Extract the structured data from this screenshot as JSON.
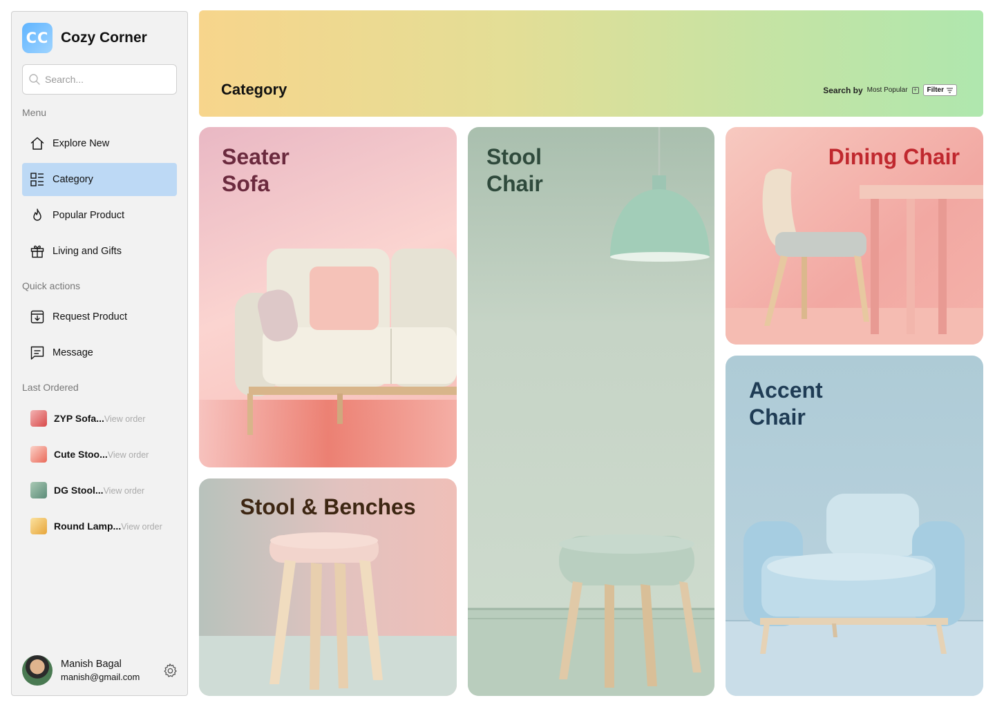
{
  "app": {
    "brand_initials": "CC",
    "brand_name": "Cozy Corner"
  },
  "search": {
    "placeholder": "Search..."
  },
  "sidebar": {
    "menu_title": "Menu",
    "menu": [
      {
        "label": "Explore New",
        "icon": "home-icon"
      },
      {
        "label": "Category",
        "icon": "category-list-icon",
        "active": true
      },
      {
        "label": "Popular Product",
        "icon": "flame-icon"
      },
      {
        "label": "Living and Gifts",
        "icon": "gift-icon"
      }
    ],
    "quick_title": "Quick actions",
    "quick": [
      {
        "label": "Request Product",
        "icon": "download-box-icon"
      },
      {
        "label": "Message",
        "icon": "message-icon"
      }
    ],
    "orders_title": "Last Ordered",
    "orders": [
      {
        "name": "ZYP Sofa...",
        "action": "View order"
      },
      {
        "name": "Cute Stoo...",
        "action": "View order"
      },
      {
        "name": "DG Stool...",
        "action": "View order"
      },
      {
        "name": "Round Lamp...",
        "action": "View order"
      }
    ]
  },
  "user": {
    "name": "Manish Bagal",
    "email": "manish@gmail.com"
  },
  "header": {
    "title": "Category",
    "search_by_label": "Search by",
    "sort_value": "Most Popular",
    "filter_label": "Filter"
  },
  "categories": [
    {
      "title": "Seater\nSofa",
      "color": "#6b2a3e"
    },
    {
      "title": "Stool\nChair",
      "color": "#2f4a3c"
    },
    {
      "title": "Dining Chair",
      "color": "#c0282e"
    },
    {
      "title": "Stool & Benches",
      "color": "#3d2612"
    },
    {
      "title": "Accent\nChair",
      "color": "#1f3c55"
    }
  ]
}
